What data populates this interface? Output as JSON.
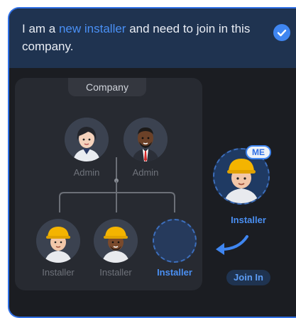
{
  "header": {
    "text_before": "I am a ",
    "text_highlight": "new installer",
    "text_after": " and need to join in this company.",
    "checked": true
  },
  "company": {
    "label": "Company",
    "admins": [
      {
        "role": "Admin",
        "avatar": "woman-admin-avatar"
      },
      {
        "role": "Admin",
        "avatar": "man-admin-avatar"
      }
    ],
    "installers": [
      {
        "role": "Installer",
        "avatar": "installer-avatar"
      },
      {
        "role": "Installer",
        "avatar": "installer-avatar"
      },
      {
        "role": "Installer",
        "avatar": "empty-slot"
      }
    ]
  },
  "me": {
    "badge": "ME",
    "role": "Installer",
    "join_label": "Join In"
  },
  "colors": {
    "accent": "#3f86f1",
    "card_bg": "#1b1d22",
    "header_bg": "#1f3350"
  }
}
